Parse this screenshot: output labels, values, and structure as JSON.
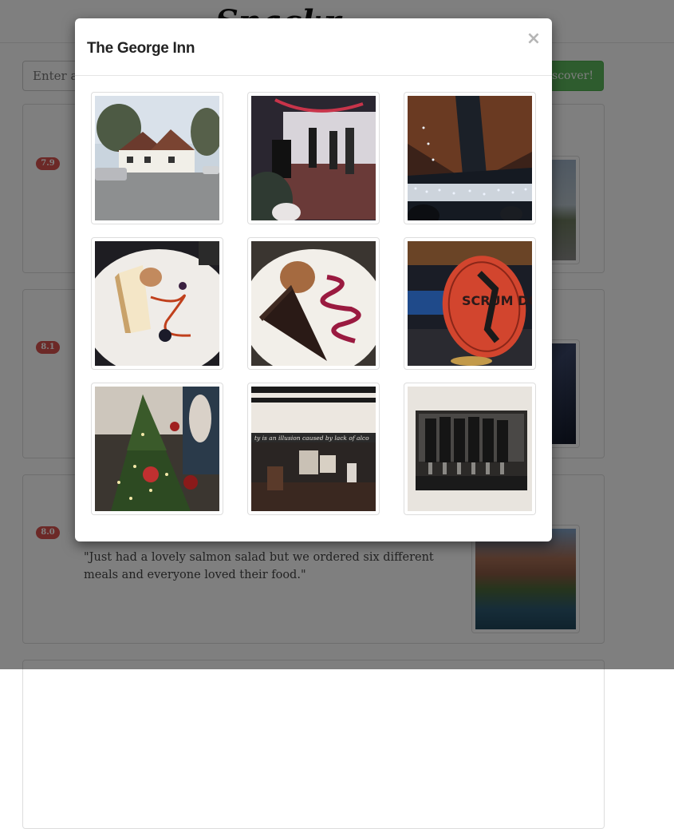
{
  "app": {
    "brand": "Snackr"
  },
  "search": {
    "placeholder": "Enter an area",
    "button_label": "Discover!"
  },
  "results": [
    {
      "score": "7.9"
    },
    {
      "score": "8.1"
    },
    {
      "score": "8.0",
      "quote": "\"Just had a lovely salmon salad but we ordered six different meals and everyone loved their food.\""
    }
  ],
  "modal": {
    "title": "The George Inn",
    "close_label": "×",
    "photos": [
      {
        "name": "pub-exterior-photo"
      },
      {
        "name": "function-room-photo"
      },
      {
        "name": "fairy-lights-ceiling-photo"
      },
      {
        "name": "cheesecake-dessert-photo"
      },
      {
        "name": "chocolate-tart-photo"
      },
      {
        "name": "scrum-down-beer-pump-photo"
      },
      {
        "name": "christmas-tree-photo"
      },
      {
        "name": "bar-interior-photo"
      },
      {
        "name": "vintage-team-photo",
        "text": ""
      }
    ],
    "sign_text": "ty is an illusion caused by lack of alco",
    "pump_text": "SCRUM DOWN"
  }
}
